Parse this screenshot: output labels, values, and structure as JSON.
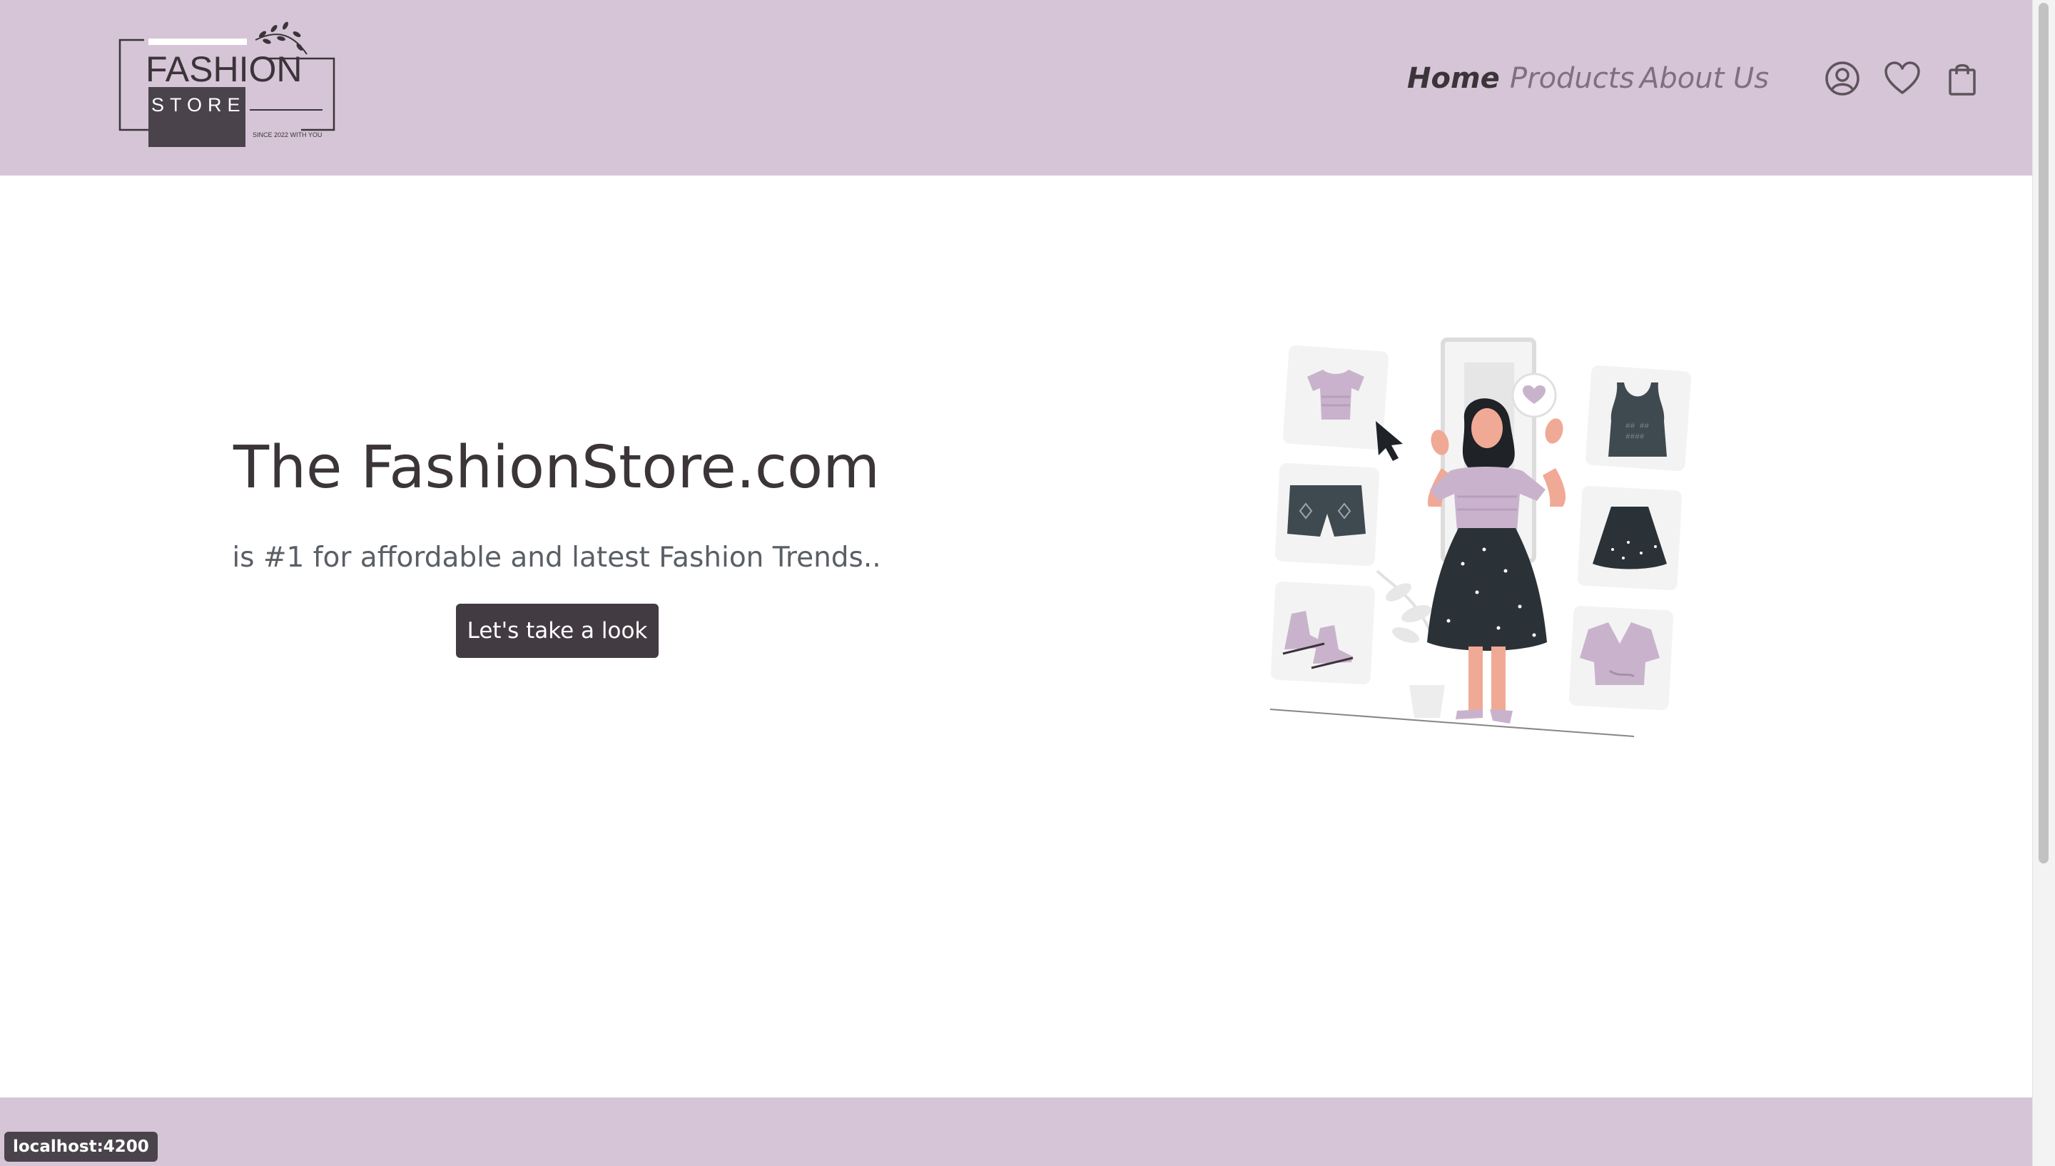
{
  "header": {
    "logo": {
      "line1": "FASHION",
      "line2": "STORE",
      "tagline": "SINCE 2022 WITH YOU"
    },
    "nav": [
      {
        "label": "Home",
        "active": true
      },
      {
        "label": "Products",
        "active": false
      },
      {
        "label": "About Us",
        "active": false
      }
    ],
    "icons": [
      "user-account-icon",
      "heart-icon",
      "shopping-bag-icon"
    ]
  },
  "hero": {
    "title": "The FashionStore.com",
    "subtitle": "is #1 for affordable and latest Fashion Trends..",
    "cta_label": "Let's take a look"
  },
  "status_bar": {
    "url": "localhost:4200"
  },
  "colors": {
    "header_bg": "#d5c5d7",
    "dark": "#433b42",
    "accent_lilac": "#c9b3cc",
    "text": "#3b3439"
  }
}
